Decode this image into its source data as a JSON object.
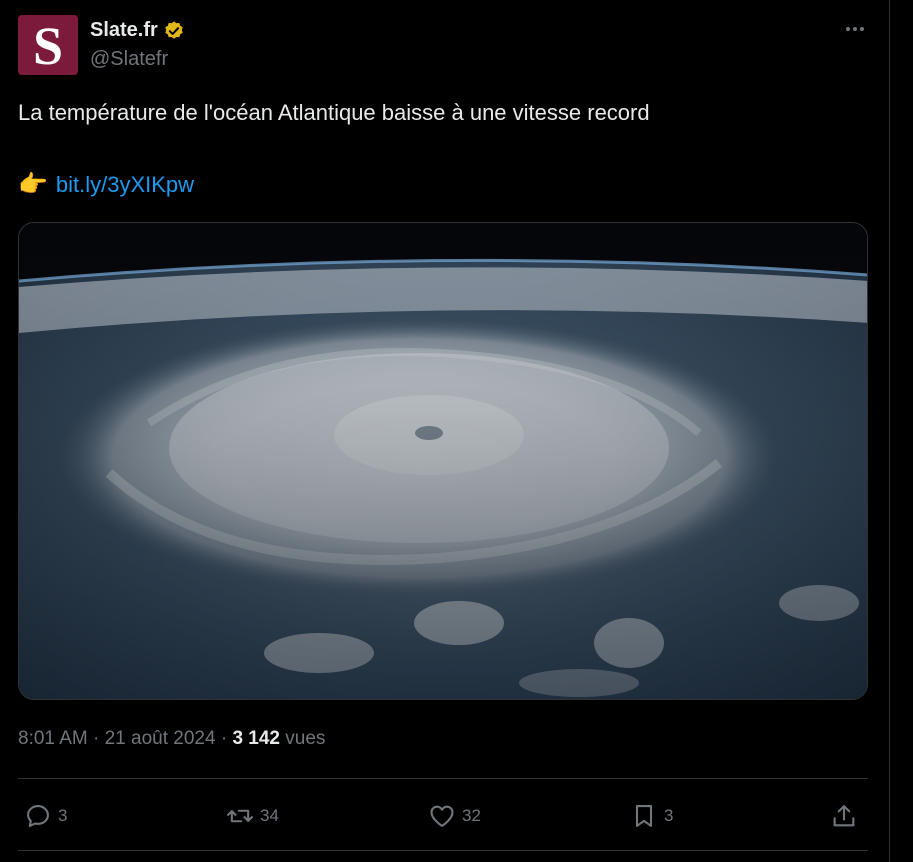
{
  "author": {
    "avatar_letter": "S",
    "display_name": "Slate.fr",
    "handle": "@Slatefr",
    "verified_color": "#e2b719",
    "avatar_color": "#7b1a3a"
  },
  "tweet": {
    "text": "La température de l'océan Atlantique baisse à une vitesse record",
    "link_emoji": "👉",
    "link_text": "bit.ly/3yXIKpw",
    "media_alt": "hurricane-from-space-image"
  },
  "meta": {
    "time": "8:01 AM",
    "separator1": "·",
    "date": "21 août 2024",
    "separator2": "·",
    "views_count": "3 142",
    "views_label": "vues"
  },
  "actions": {
    "replies": "3",
    "retweets": "34",
    "likes": "32",
    "bookmarks": "3"
  },
  "colors": {
    "link": "#1d9bf0",
    "muted": "#71767b",
    "text": "#e7e9ea",
    "background": "#000000",
    "border": "#2f3336"
  }
}
